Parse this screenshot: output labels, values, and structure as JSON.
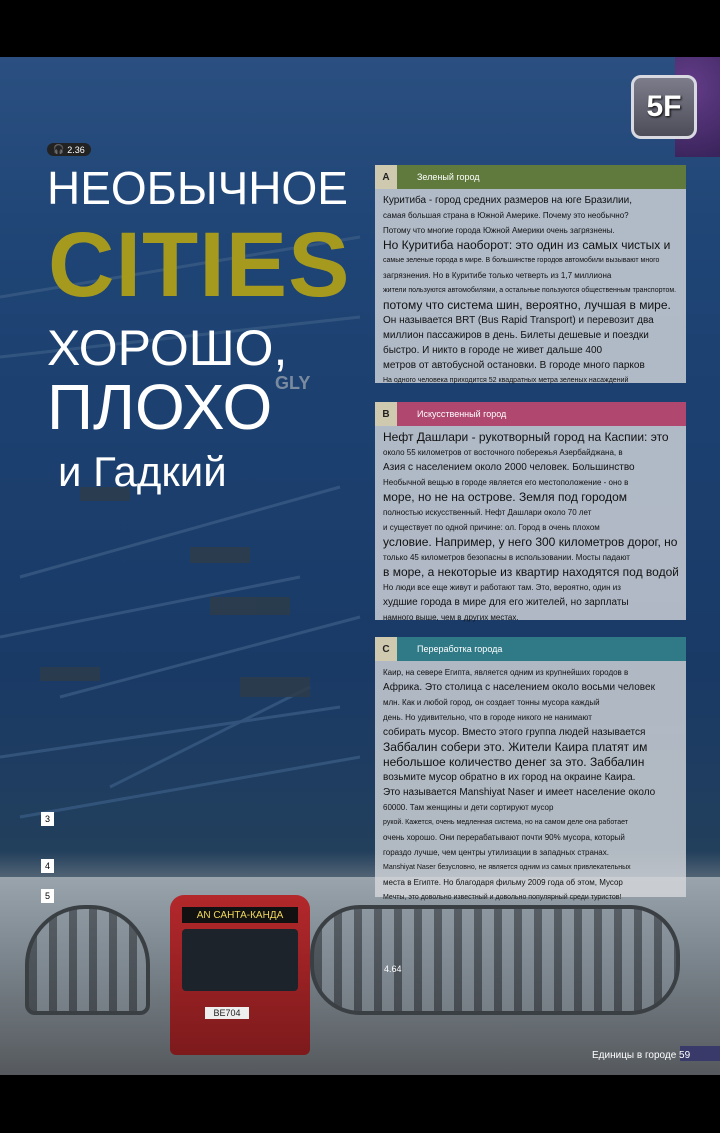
{
  "badge": "5F",
  "audio": "2.36",
  "titles": {
    "main1": "НЕОБЫЧНОЕ",
    "cities": "CITIES",
    "main2": "ХОРОШО,",
    "main3": "ПЛОХО",
    "main4": "и Гадкий",
    "ghost": "GLY"
  },
  "panels": [
    {
      "letter": "A",
      "heading": "Зеленый город",
      "color": "#5f7a3c",
      "lines": [
        {
          "t": "Куритиба - город средних размеров на юге Бразилии,",
          "c": "m"
        },
        {
          "t": "самая большая страна в Южной Америке. Почему это необычно?",
          "c": "s"
        },
        {
          "t": "Потому что многие города Южной Америки очень загрязнены.",
          "c": "s"
        },
        {
          "t": "Но Куритиба наоборот: это один из самых чистых и",
          "c": "l"
        },
        {
          "t": "самые зеленые города в мире. В большинстве городов автомобили вызывают много",
          "c": "xs"
        },
        {
          "t": "загрязнения. Но в Куритибе только четверть из 1,7 миллиона",
          "c": "s"
        },
        {
          "t": "жители пользуются автомобилями, а остальные пользуются общественным транспортом. Это",
          "c": "xs"
        },
        {
          "t": "потому что система шин, вероятно, лучшая в мире.",
          "c": "l"
        },
        {
          "t": "Он называется BRT (Bus Rapid Transport) и перевозит два",
          "c": "m"
        },
        {
          "t": "миллион пассажиров в день. Билеты дешевые и поездки",
          "c": "m"
        },
        {
          "t": "быстро. И никто в городе не живет дальше 400",
          "c": "m"
        },
        {
          "t": "метров от автобусной остановки. В городе много парков",
          "c": "m"
        },
        {
          "t": "На одного человека приходится 52 квадратных метра зеленых насаждений",
          "c": "xs"
        }
      ]
    },
    {
      "letter": "B",
      "heading": "Искусственный город",
      "color": "#b0476f",
      "lines": [
        {
          "t": "Нефт Дашлари - рукотворный город на Каспии: это",
          "c": "l"
        },
        {
          "t": "около 55 километров от восточного побережья Азербайджана, в",
          "c": "s"
        },
        {
          "t": "Азия с населением около 2000 человек. Большинство",
          "c": "m"
        },
        {
          "t": "Необычной вещью в городе является его местоположение - оно в",
          "c": "s"
        },
        {
          "t": "море, но не на острове. Земля под городом",
          "c": "l"
        },
        {
          "t": "полностью искусственный. Нефт Дашлари около 70 лет",
          "c": "s"
        },
        {
          "t": "и существует по одной причине: ол. Город в очень плохом",
          "c": "s"
        },
        {
          "t": "условие. Например, у него 300 километров дорог, но",
          "c": "l"
        },
        {
          "t": "только 45 километров безопасны в использовании. Мосты падают",
          "c": "s"
        },
        {
          "t": "в море, а некоторые из квартир находятся под водой.",
          "c": "l"
        },
        {
          "t": "Но люди все еще живут и работают там. Это, вероятно, один из",
          "c": "s"
        },
        {
          "t": "худшие города в мире для его жителей, но зарплаты",
          "c": "m"
        },
        {
          "t": "намного выше, чем в других местах.",
          "c": "s"
        }
      ]
    },
    {
      "letter": "C",
      "heading": "Переработка города",
      "color": "#2f7a86",
      "lines": [
        {
          "t": "Каир, на севере Египта, является одним из крупнейших городов в",
          "c": "s"
        },
        {
          "t": "Африка. Это столица с населением около восьми человек",
          "c": "m"
        },
        {
          "t": "млн. Как и любой город, он создает тонны мусора каждый",
          "c": "s"
        },
        {
          "t": "день. Но удивительно, что в городе никого не нанимают",
          "c": "s"
        },
        {
          "t": "собирать мусор. Вместо этого группа людей называется",
          "c": "m"
        },
        {
          "t": "Заббалин собери это. Жители Каира платят им",
          "c": "l"
        },
        {
          "t": "небольшое количество денег за это. Заббалин",
          "c": "l"
        },
        {
          "t": "возьмите мусор обратно в их город на окраине Каира.",
          "c": "m"
        },
        {
          "t": "Это называется Manshiyat Naser и имеет население около",
          "c": "m"
        },
        {
          "t": "60000. Там женщины и дети сортируют мусор",
          "c": "s"
        },
        {
          "t": "рукой. Кажется, очень медленная система, но на самом деле она работает",
          "c": "xs"
        },
        {
          "t": "очень хорошо. Они перерабатывают почти 90% мусора, который",
          "c": "s"
        },
        {
          "t": "гораздо лучше, чем центры утилизации в западных странах.",
          "c": "s"
        },
        {
          "t": "Manshiyat Naser безусловно, не является одним из самых привлекательных",
          "c": "xs"
        },
        {
          "t": "места в Египте. Но благодаря фильму 2009 года об этом, Мусор",
          "c": "s"
        },
        {
          "t": "Мечты, это довольно известный и довольно популярный среди туристов!",
          "c": "xs"
        }
      ]
    }
  ],
  "numbers": [
    "3",
    "4",
    "5"
  ],
  "bus_sign": "AN САНТА-КАНДА",
  "bus_plate": "BE704",
  "label_464": "4.64",
  "footer": "Единицы в городе 59"
}
